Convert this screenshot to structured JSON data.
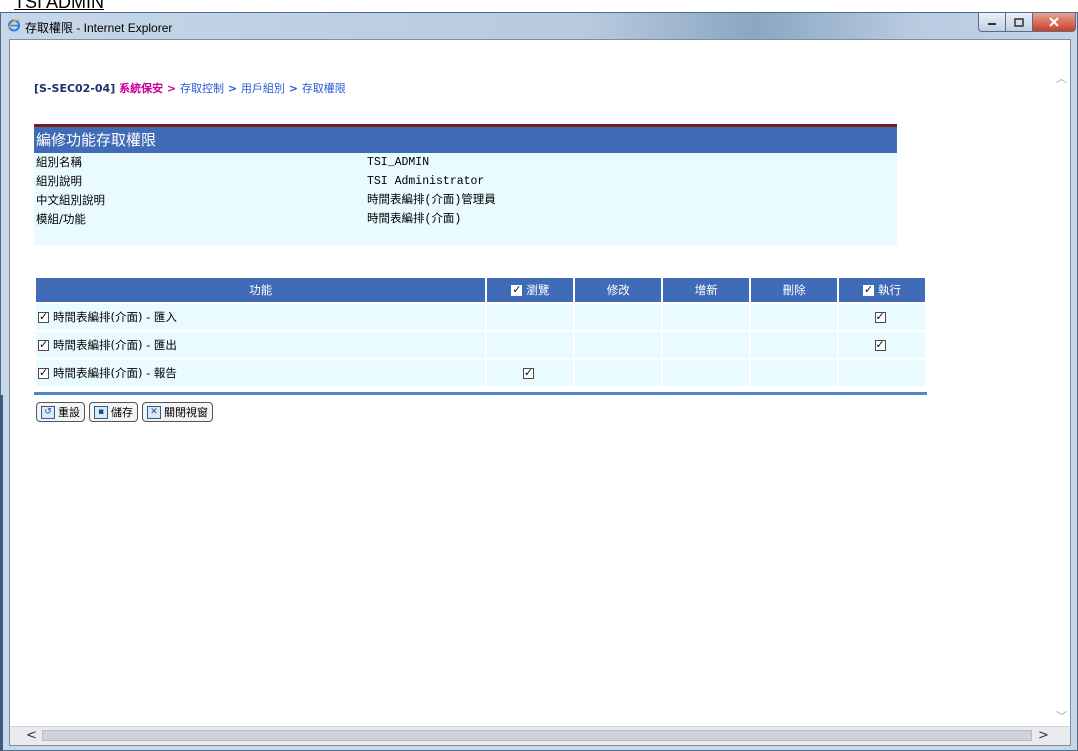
{
  "doc_heading": "TSI ADMIN",
  "window": {
    "title": "存取權限 - Internet Explorer",
    "controls": {
      "minimize": "–",
      "maximize": "□",
      "close": "✕"
    }
  },
  "breadcrumb": {
    "code": "[S-SEC02-04]",
    "section": "系統保安",
    "sep1": ">",
    "level2": "存取控制",
    "sep2": ">",
    "level3": "用戶組別",
    "sep3": ">",
    "level4": "存取權限"
  },
  "info_panel": {
    "header": "編修功能存取權限",
    "rows": [
      {
        "label": "組別名稱",
        "value": "TSI_ADMIN"
      },
      {
        "label": "組別說明",
        "value": "TSI Administrator"
      },
      {
        "label": "中文組別說明",
        "value": "時間表編排(介面)管理員"
      },
      {
        "label": "模組/功能",
        "value": "時間表編排(介面)"
      }
    ]
  },
  "permissions": {
    "columns": {
      "function": "功能",
      "view": "瀏覽",
      "modify": "修改",
      "add": "增新",
      "delete": "刪除",
      "execute": "執行"
    },
    "header_checks": {
      "view": true,
      "execute": true
    },
    "rows": [
      {
        "function": "時間表編排(介面) - 匯入",
        "selected": true,
        "view": false,
        "modify": false,
        "add": false,
        "delete": false,
        "execute": true
      },
      {
        "function": "時間表編排(介面) - 匯出",
        "selected": true,
        "view": false,
        "modify": false,
        "add": false,
        "delete": false,
        "execute": true
      },
      {
        "function": "時間表編排(介面) - 報告",
        "selected": true,
        "view": true,
        "modify": false,
        "add": false,
        "delete": false,
        "execute": false
      }
    ]
  },
  "buttons": {
    "reset": "重設",
    "save": "儲存",
    "close": "關閉視窗"
  },
  "scroll": {
    "up": "︿",
    "down": "﹀",
    "left": "<",
    "right": ">"
  }
}
